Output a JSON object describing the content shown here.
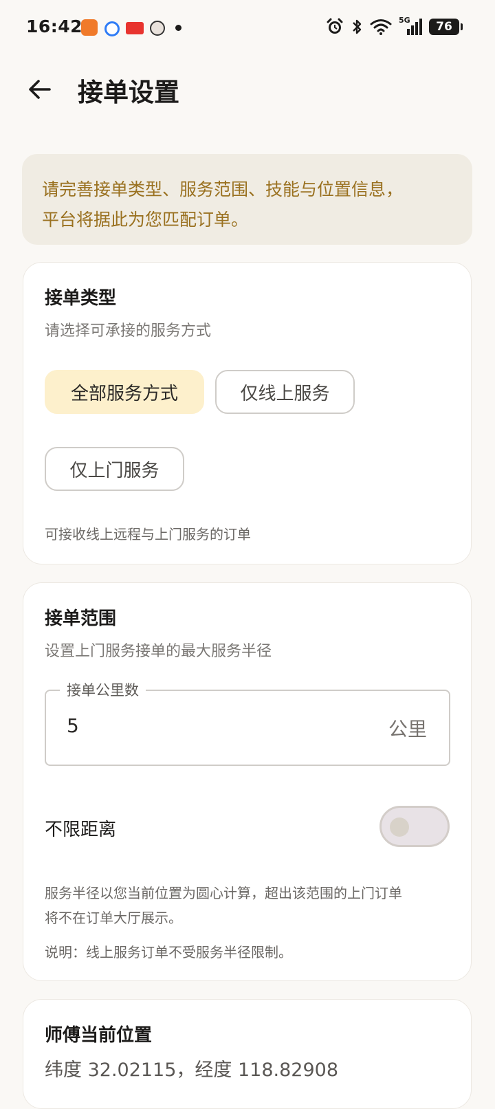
{
  "status_bar": {
    "time": "16:42",
    "network": "5G",
    "battery": "76"
  },
  "header": {
    "title": "接单设置",
    "back_icon": "arrow-left-icon"
  },
  "notice": {
    "line1": "请完善接单类型、服务范围、技能与位置信息，",
    "line2": "平台将据此为您匹配订单。"
  },
  "order_type": {
    "title": "接单类型",
    "subtitle": "请选择可承接的服务方式",
    "options": [
      {
        "label": "全部服务方式",
        "selected": true
      },
      {
        "label": "仅线上服务",
        "selected": false
      },
      {
        "label": "仅上门服务",
        "selected": false
      }
    ],
    "note": "可接收线上远程与上门服务的订单"
  },
  "order_range": {
    "title": "接单范围",
    "subtitle": "设置上门服务接单的最大服务半径",
    "km_label": "接单公里数",
    "km_value": "5",
    "km_unit": "公里",
    "unlimited_label": "不限距离",
    "unlimited_on": false,
    "note_line1": "服务半径以您当前位置为圆心计算，超出该范围的上门订单",
    "note_line2": "将不在订单大厅展示。",
    "note_extra": "说明：线上服务订单不受服务半径限制。"
  },
  "location": {
    "title": "师傅当前位置",
    "coords": "纬度 32.02115，经度 118.82908"
  }
}
